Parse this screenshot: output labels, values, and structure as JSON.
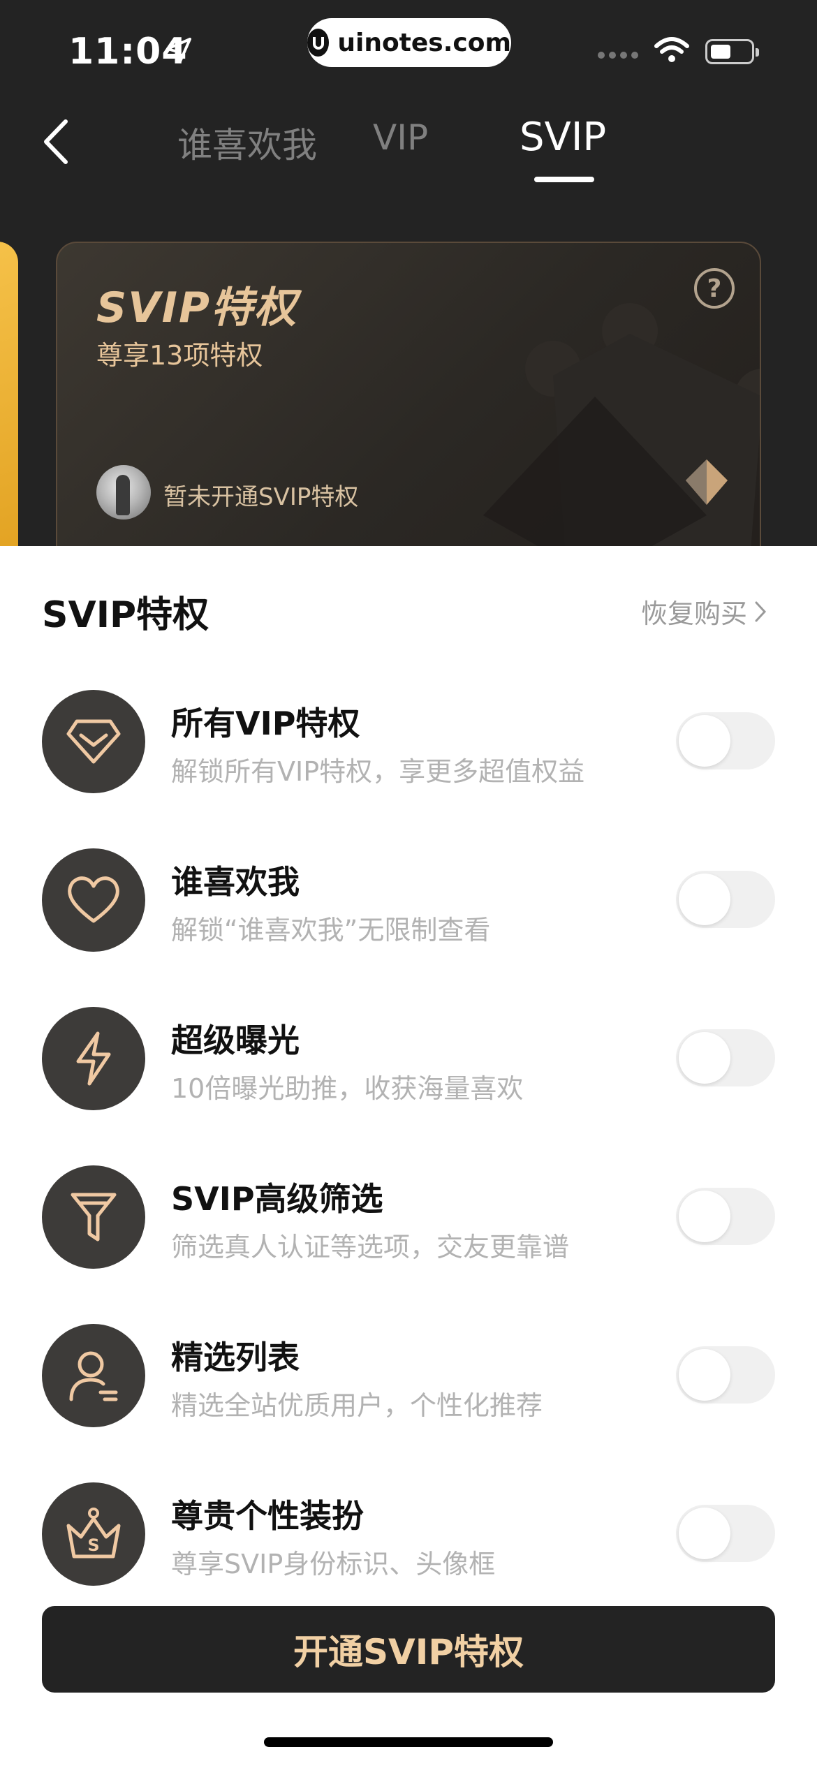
{
  "status_bar": {
    "time": "11:04",
    "watermark": "uinotes.com"
  },
  "nav": {
    "tabs": [
      "谁喜欢我",
      "VIP",
      "SVIP"
    ],
    "active_tab": "SVIP"
  },
  "card": {
    "title": "SVIP特权",
    "subtitle": "尊享13项特权",
    "help": "?",
    "status": "暂未开通SVIP特权"
  },
  "section": {
    "title": "SVIP特权",
    "restore_label": "恢复购买"
  },
  "privileges": [
    {
      "icon": "diamond-icon",
      "title": "所有VIP特权",
      "desc": "解锁所有VIP特权，享更多超值权益",
      "enabled": false
    },
    {
      "icon": "heart-icon",
      "title": "谁喜欢我",
      "desc": "解锁“谁喜欢我”无限制查看",
      "enabled": false
    },
    {
      "icon": "lightning-icon",
      "title": "超级曝光",
      "desc": "10倍曝光助推，收获海量喜欢",
      "enabled": false
    },
    {
      "icon": "filter-icon",
      "title": "SVIP高级筛选",
      "desc": "筛选真人认证等选项，交友更靠谱",
      "enabled": false
    },
    {
      "icon": "user-list-icon",
      "title": "精选列表",
      "desc": "精选全站优质用户，个性化推荐",
      "enabled": false
    },
    {
      "icon": "crown-s-icon",
      "title": "尊贵个性装扮",
      "desc": "尊享SVIP身份标识、头像框",
      "enabled": false
    }
  ],
  "cta": {
    "label": "开通SVIP特权"
  },
  "colors": {
    "dark": "#232323",
    "gold": "#e7c59a",
    "icon_stroke": "#f0c9a3",
    "cta_text": "#f1d0a4"
  }
}
